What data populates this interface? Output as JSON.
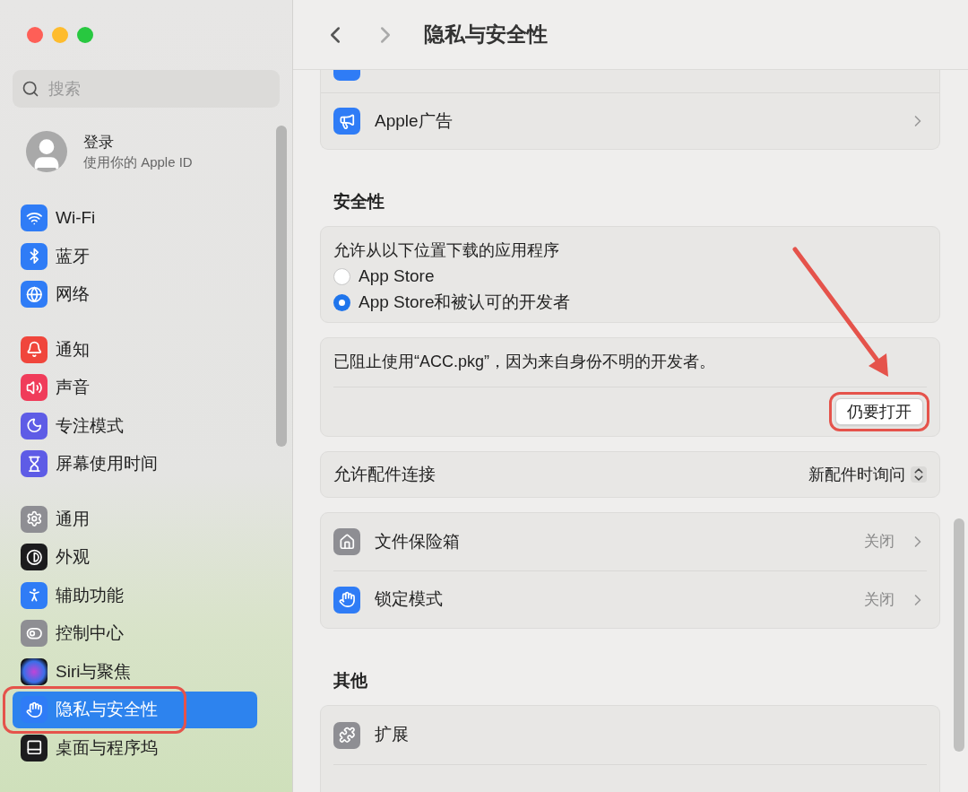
{
  "window": {
    "title": "隐私与安全性"
  },
  "sidebar": {
    "search": {
      "placeholder": "搜索"
    },
    "account": {
      "name": "登录",
      "subtitle": "使用你的 Apple ID"
    },
    "groups": [
      {
        "items": [
          {
            "kind": "wifi",
            "label": "Wi-Fi",
            "selected": false,
            "highlighted": false
          },
          {
            "kind": "bluetooth",
            "label": "蓝牙",
            "selected": false,
            "highlighted": false
          },
          {
            "kind": "network",
            "label": "网络",
            "selected": false,
            "highlighted": false
          }
        ]
      },
      {
        "items": [
          {
            "kind": "notifications",
            "label": "通知",
            "selected": false,
            "highlighted": false
          },
          {
            "kind": "sound",
            "label": "声音",
            "selected": false,
            "highlighted": false
          },
          {
            "kind": "focus",
            "label": "专注模式",
            "selected": false,
            "highlighted": false
          },
          {
            "kind": "screentime",
            "label": "屏幕使用时间",
            "selected": false,
            "highlighted": false
          }
        ]
      },
      {
        "items": [
          {
            "kind": "general",
            "label": "通用",
            "selected": false,
            "highlighted": false
          },
          {
            "kind": "appearance",
            "label": "外观",
            "selected": false,
            "highlighted": false
          },
          {
            "kind": "accessibility",
            "label": "辅助功能",
            "selected": false,
            "highlighted": false
          },
          {
            "kind": "control",
            "label": "控制中心",
            "selected": false,
            "highlighted": false
          },
          {
            "kind": "siri",
            "label": "Siri与聚焦",
            "selected": false,
            "highlighted": false
          },
          {
            "kind": "privacy",
            "label": "隐私与安全性",
            "selected": true,
            "highlighted": true
          },
          {
            "kind": "dock",
            "label": "桌面与程序坞",
            "selected": false,
            "highlighted": false
          }
        ]
      }
    ]
  },
  "top_card": {
    "rows": [
      {
        "kind": "ads",
        "label": "Apple广告"
      }
    ]
  },
  "security": {
    "heading": "安全性",
    "download_card": {
      "label": "允许从以下位置下载的应用程序",
      "options": [
        {
          "label": "App Store",
          "selected": false
        },
        {
          "label": "App Store和被认可的开发者",
          "selected": true
        }
      ]
    },
    "blocked_card": {
      "message": "已阻止使用“ACC.pkg”，因为来自身份不明的开发者。",
      "callout_arrow": true,
      "button": {
        "label": "仍要打开",
        "highlighted": true
      }
    },
    "accessory": {
      "label": "允许配件连接",
      "value": "新配件时询问"
    },
    "rows": [
      {
        "kind": "vault",
        "label": "文件保险箱",
        "value": "关闭"
      },
      {
        "kind": "lockdown",
        "label": "锁定模式",
        "value": "关闭"
      }
    ]
  },
  "other": {
    "heading": "其他",
    "rows": [
      {
        "kind": "extensions",
        "label": "扩展"
      }
    ]
  }
}
